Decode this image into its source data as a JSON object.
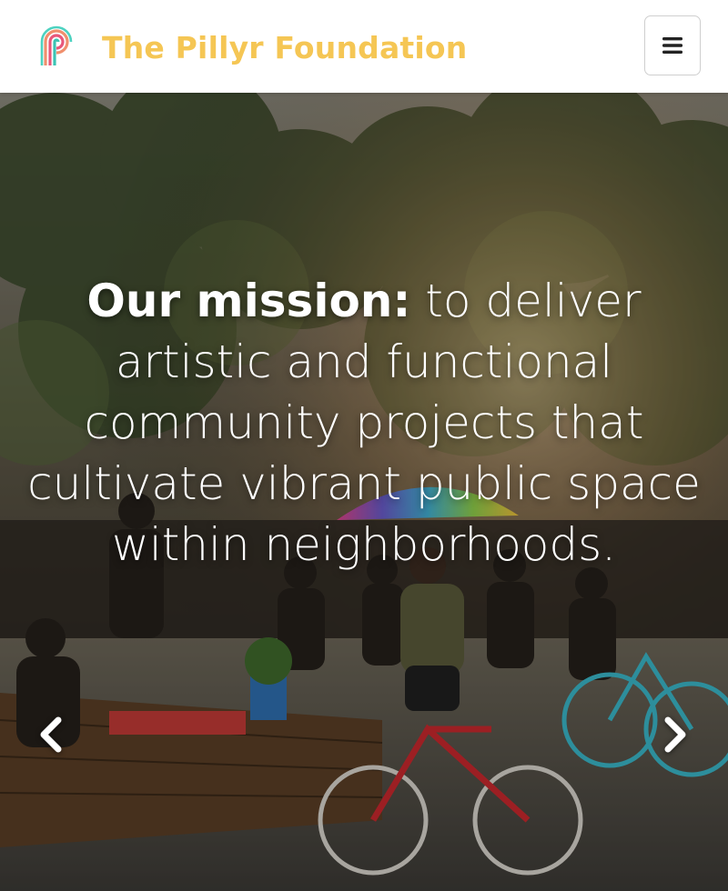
{
  "navbar": {
    "brand_name": "The Pillyr Foundation",
    "brand_color": "#f5c654",
    "logo_icon": "pillyr-logo-icon",
    "menu_icon": "hamburger-menu-icon"
  },
  "hero": {
    "mission_label": "Our mission:",
    "mission_text": " to deliver artistic and functional community projects that cultivate vibrant public space within neighborhoods.",
    "background_description_icon": "street-festival-photo",
    "prev_icon": "chevron-left-icon",
    "next_icon": "chevron-right-icon"
  }
}
